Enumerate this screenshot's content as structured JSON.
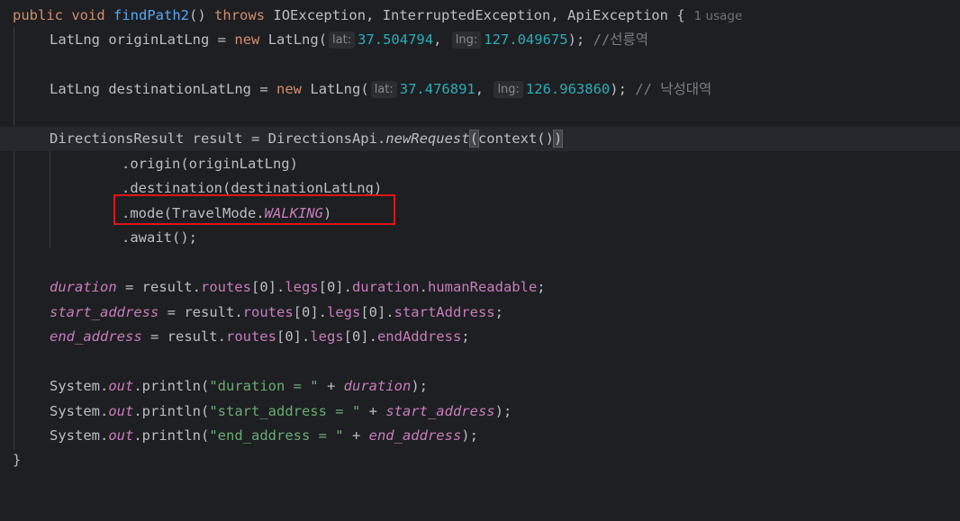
{
  "method": {
    "kw_public": "public",
    "kw_void": "void",
    "name": "findPath2",
    "params": "()",
    "kw_throws": "throws",
    "exceptions": "IOException, InterruptedException, ApiException {",
    "usage_hint": "1 usage"
  },
  "lines": {
    "origin": {
      "type": "LatLng",
      "var": "originLatLng",
      "eq": "=",
      "kw_new": "new",
      "ctor": "LatLng(",
      "hint_lat": "lat:",
      "lat": "37.504794",
      "comma": ",",
      "hint_lng": "lng:",
      "lng": "127.049675",
      "end": ");",
      "comment": "//선릉역"
    },
    "destination": {
      "type": "LatLng",
      "var": "destinationLatLng",
      "eq": "=",
      "kw_new": "new",
      "ctor": "LatLng(",
      "hint_lat": "lat:",
      "lat": "37.476891",
      "comma": ",",
      "hint_lng": "lng:",
      "lng": "126.963860",
      "end": ");",
      "comment": "// 낙성대역"
    },
    "request": {
      "lhs": "DirectionsResult result = DirectionsApi.",
      "method": "newRequest",
      "open": "(",
      "args": "context()",
      "close": ")"
    },
    "chain": {
      "origin": ".origin(originLatLng)",
      "destination": ".destination(destinationLatLng)",
      "mode_prefix": ".mode(TravelMode.",
      "mode_value": "WALKING",
      "mode_suffix": ")",
      "await": ".await();"
    },
    "assign_duration": {
      "var": "duration",
      "mid1": " = result.",
      "routes": "routes",
      "idx1": "[0].",
      "legs": "legs",
      "idx2": "[0].",
      "f1": "duration",
      "dot": ".",
      "f2": "humanReadable",
      "end": ";"
    },
    "assign_start": {
      "var": "start_address",
      "mid1": " = result.",
      "routes": "routes",
      "idx1": "[0].",
      "legs": "legs",
      "idx2": "[0].",
      "f1": "startAddress",
      "end": ";"
    },
    "assign_end": {
      "var": "end_address",
      "mid1": " = result.",
      "routes": "routes",
      "idx1": "[0].",
      "legs": "legs",
      "idx2": "[0].",
      "f1": "endAddress",
      "end": ";"
    },
    "print_duration": {
      "sys": "System.",
      "out": "out",
      "call": ".println(",
      "str": "\"duration = \"",
      "plus": " + ",
      "var": "duration",
      "end": ");"
    },
    "print_start": {
      "sys": "System.",
      "out": "out",
      "call": ".println(",
      "str": "\"start_address = \"",
      "plus": " + ",
      "var": "start_address",
      "end": ");"
    },
    "print_end": {
      "sys": "System.",
      "out": "out",
      "call": ".println(",
      "str": "\"end_address = \"",
      "plus": " + ",
      "var": "end_address",
      "end": ");"
    },
    "closing_brace": "}"
  },
  "colors": {
    "background": "#1e1f22",
    "keyword": "#cf8e6d",
    "function": "#56a8f5",
    "number": "#2aacb8",
    "string": "#6aab73",
    "field": "#c77dbb",
    "comment": "#7a7e85",
    "highlight_box": "#e0141a"
  }
}
